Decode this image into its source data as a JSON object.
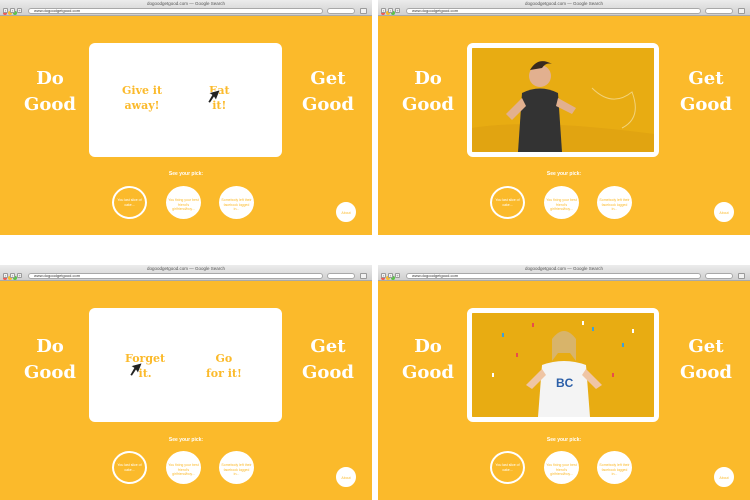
{
  "browser": {
    "title": "dogoodgetgood.com — Google Search",
    "url": "www.dogoodgetgood.com"
  },
  "page": {
    "left_lines": [
      "Do",
      "Good"
    ],
    "right_lines": [
      "Get",
      "Good"
    ],
    "see_your_pick": "See your pick:",
    "picks": [
      "You last slice of cake...",
      "You fixing your best friend's girlfriend/boy...",
      "Somebody left their facebook logged in..."
    ],
    "about": "About"
  },
  "panel_top_left": {
    "choice_a": [
      "Give it",
      "away!"
    ],
    "choice_b": [
      "Eat",
      "it!"
    ]
  },
  "panel_bottom_left": {
    "choice_a": [
      "Forget",
      "it."
    ],
    "choice_b": [
      "Go",
      "for it!"
    ]
  },
  "colors": {
    "background": "#fbba2b",
    "white": "#ffffff"
  }
}
